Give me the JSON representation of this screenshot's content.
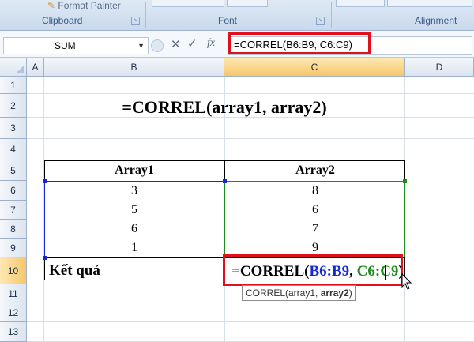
{
  "ribbon": {
    "groups": [
      {
        "label": "Clipboard"
      },
      {
        "label": "Font"
      },
      {
        "label": "Alignment"
      }
    ],
    "format_painter_label": "Format Painter"
  },
  "formula_bar": {
    "name_box": "SUM",
    "fx_label": "fx",
    "formula": "=CORREL(B6:B9, C6:C9)"
  },
  "sheet": {
    "columns": [
      "A",
      "B",
      "C",
      "D"
    ],
    "rows": [
      "1",
      "2",
      "3",
      "4",
      "5",
      "6",
      "7",
      "8",
      "9",
      "10",
      "11",
      "12",
      "13"
    ],
    "selected_column": "C",
    "selected_row": "10",
    "headline": "=CORREL(array1, array2)",
    "table": {
      "headers": [
        "Array1",
        "Array2"
      ],
      "array1": [
        "3",
        "5",
        "6",
        "1"
      ],
      "array2": [
        "8",
        "6",
        "7",
        "9"
      ]
    },
    "result_label": "Kết quả",
    "edit_formula": {
      "prefix": "=CORREL(",
      "ref1": "B6:B9",
      "comma": ", ",
      "ref2": "C6:C9",
      "suffix": ")"
    },
    "tooltip": {
      "prefix": "CORREL(array1, ",
      "bold_arg": "array2",
      "suffix": ")"
    }
  },
  "colors": {
    "ref1_color": "#1428d8",
    "ref2_color": "#1d8a1d",
    "highlight_red": "#e0101d",
    "header_selected": "#f6c76a"
  }
}
